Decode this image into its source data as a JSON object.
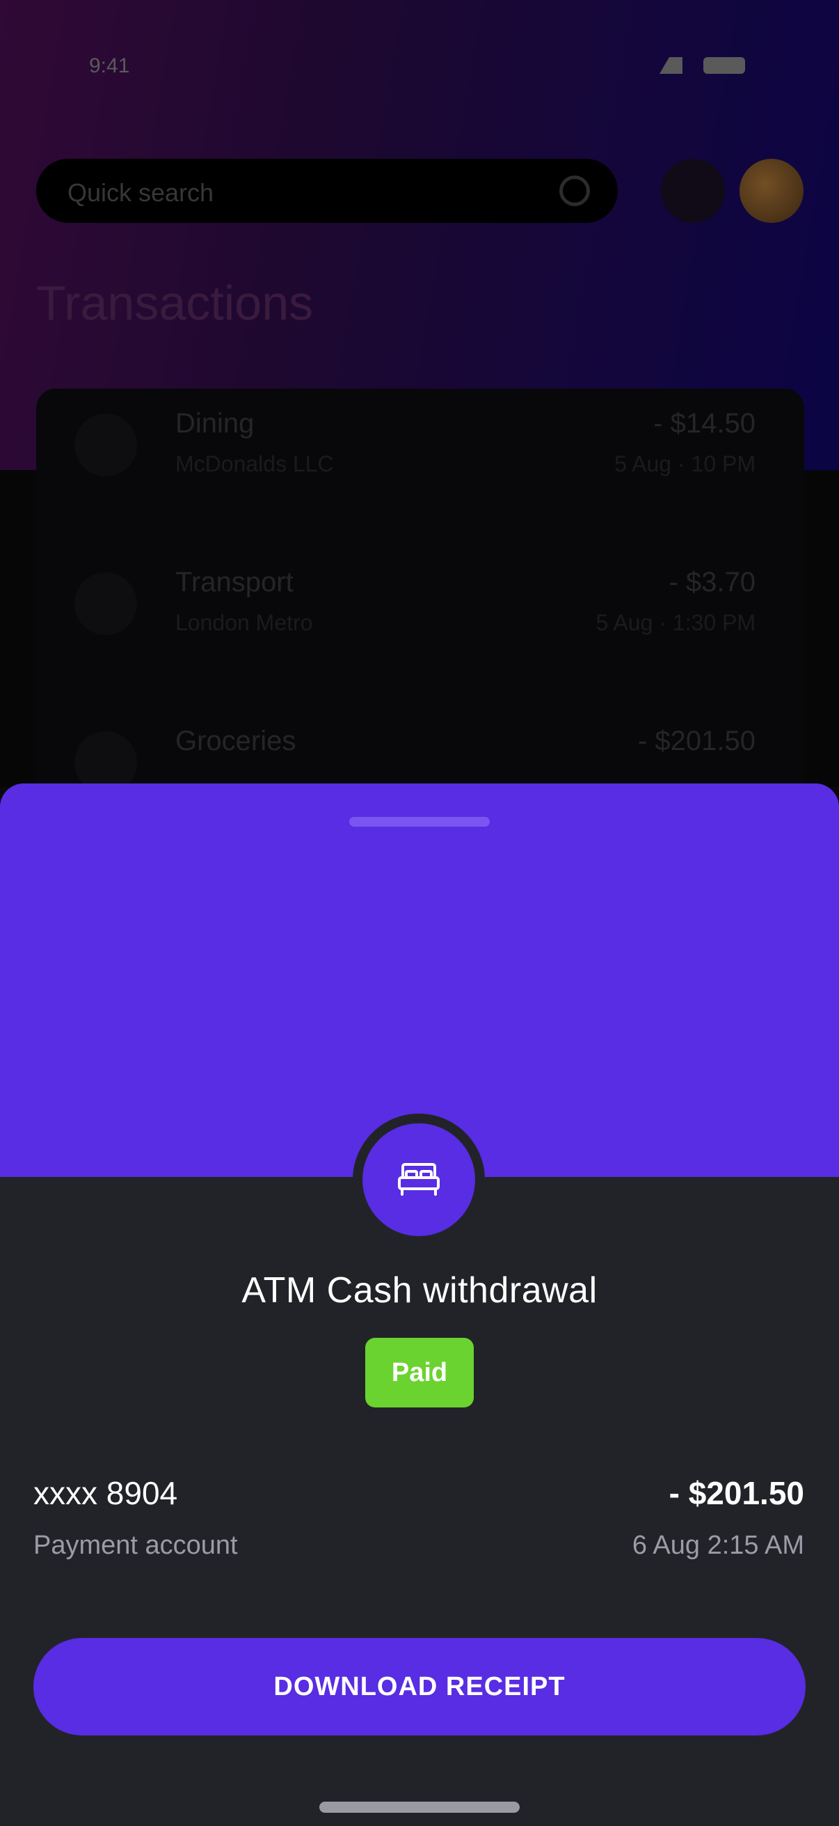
{
  "status_bar": {
    "time": "9:41"
  },
  "background_app": {
    "search_placeholder": "Quick search",
    "title": "Transactions",
    "transactions": [
      {
        "title": "Dining",
        "subtitle": "McDonalds LLC",
        "amount": "- $14.50",
        "time": "5 Aug · 10 PM"
      },
      {
        "title": "Transport",
        "subtitle": "London Metro",
        "amount": "- $3.70",
        "time": "5 Aug · 1:30 PM"
      },
      {
        "title": "Groceries",
        "subtitle": "",
        "amount": "- $201.50",
        "time": ""
      }
    ]
  },
  "sheet": {
    "icon": "bed-icon",
    "title": "ATM Cash withdrawal",
    "status": "Paid",
    "account_number": "xxxx 8904",
    "account_label": "Payment account",
    "amount": "- $201.50",
    "datetime": "6 Aug 2:15 AM",
    "download_label": "DOWNLOAD RECEIPT"
  },
  "colors": {
    "accent": "#582de3",
    "sheet_bg": "#222328",
    "paid": "#6ad32f"
  }
}
